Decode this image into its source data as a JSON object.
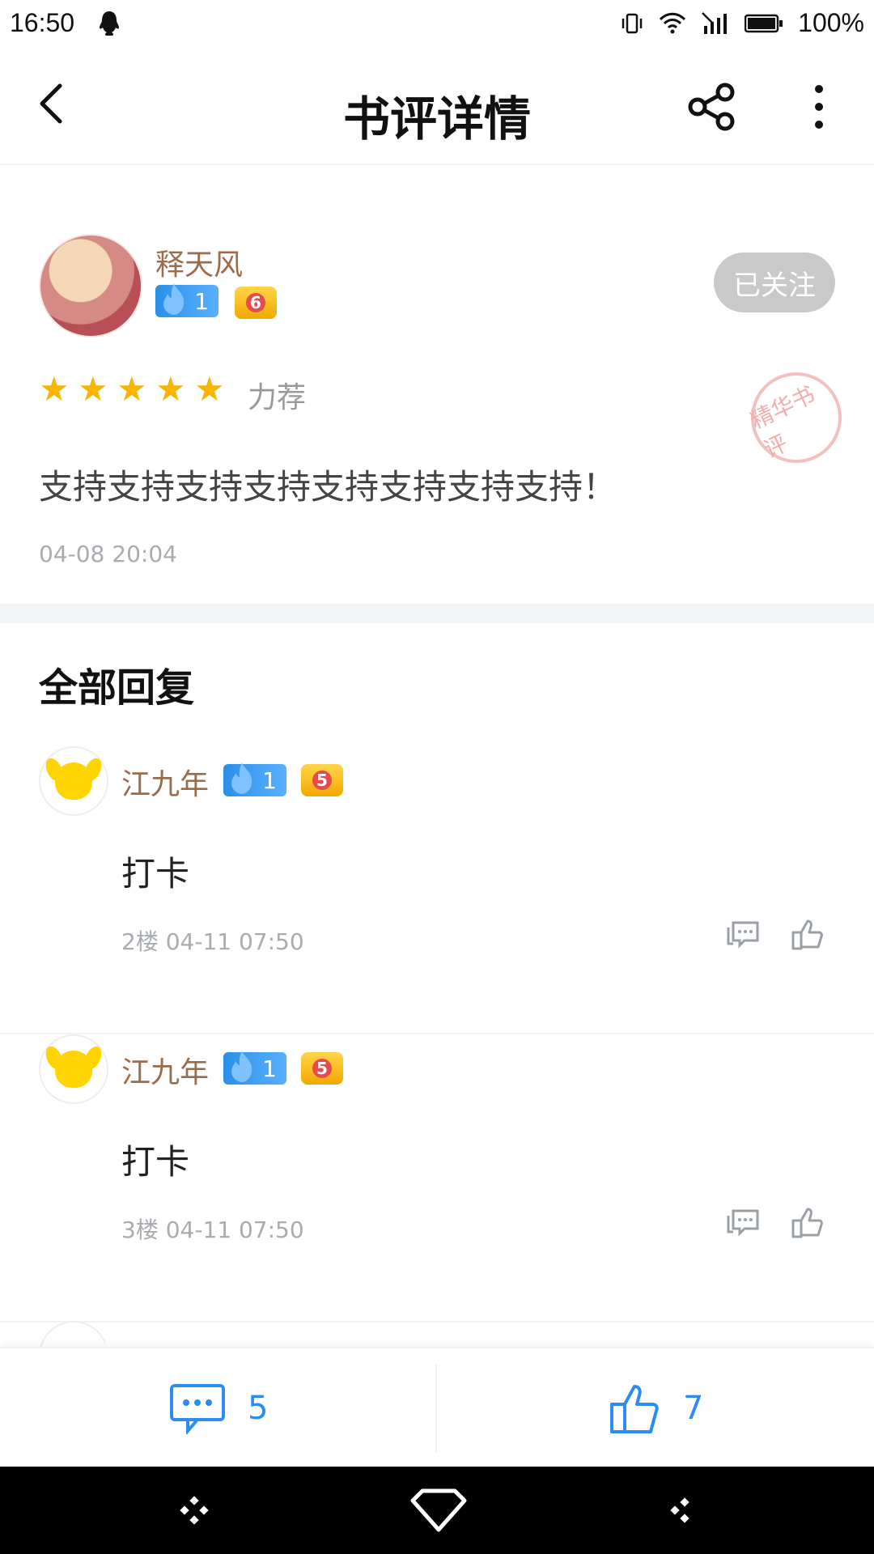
{
  "status_bar": {
    "time": "16:50",
    "battery": "100%"
  },
  "app_bar": {
    "title": "书评详情"
  },
  "review": {
    "author_name": "释天风",
    "author_level": "1",
    "author_rank": "6",
    "follow_label": "已关注",
    "rating_label": "力荐",
    "stamp_text": "精华书评",
    "content": "支持支持支持支持支持支持支持支持！",
    "time": "04-08 20:04"
  },
  "replies": {
    "section_title": "全部回复",
    "items": [
      {
        "name": "江九年",
        "level": "1",
        "rank": "5",
        "content": "打卡",
        "meta": "2楼 04-11 07:50"
      },
      {
        "name": "江九年",
        "level": "1",
        "rank": "5",
        "content": "打卡",
        "meta": "3楼 04-11 07:50"
      }
    ]
  },
  "bottom_bar": {
    "comment_count": "5",
    "like_count": "7"
  },
  "colors": {
    "accent": "#2d8cf0",
    "name": "#9b6b4c",
    "star": "#f6b600"
  }
}
